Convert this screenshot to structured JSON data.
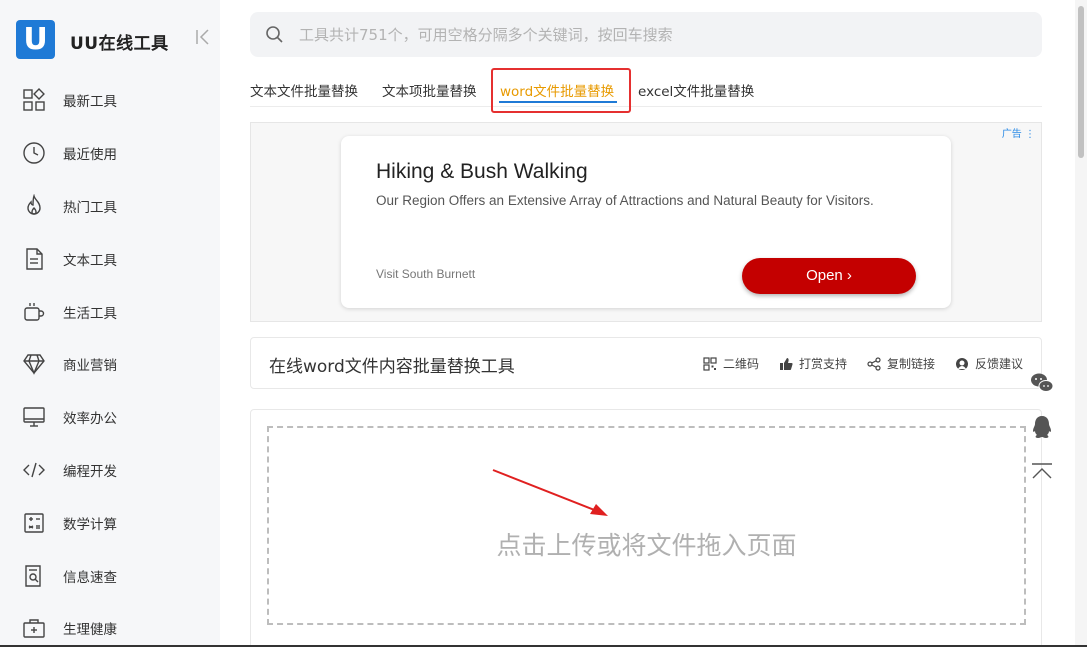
{
  "app": {
    "logo_letter": "U",
    "title": "UU在线工具",
    "collapse_glyph": "<|"
  },
  "sidebar": {
    "items": [
      {
        "label": "最新工具",
        "icon": "grid-icon"
      },
      {
        "label": "最近使用",
        "icon": "clock-icon"
      },
      {
        "label": "热门工具",
        "icon": "flame-icon"
      },
      {
        "label": "文本工具",
        "icon": "document-icon"
      },
      {
        "label": "生活工具",
        "icon": "cup-icon"
      },
      {
        "label": "商业营销",
        "icon": "diamond-icon"
      },
      {
        "label": "效率办公",
        "icon": "monitor-icon"
      },
      {
        "label": "编程开发",
        "icon": "code-icon"
      },
      {
        "label": "数学计算",
        "icon": "calculator-icon"
      },
      {
        "label": "信息速查",
        "icon": "search-doc-icon"
      },
      {
        "label": "生理健康",
        "icon": "medkit-icon"
      }
    ]
  },
  "search": {
    "placeholder": "工具共计751个，可用空格分隔多个关键词，按回车搜索",
    "value": ""
  },
  "tabs": [
    {
      "label": "文本文件批量替换",
      "active": false
    },
    {
      "label": "文本项批量替换",
      "active": false
    },
    {
      "label": "word文件批量替换",
      "active": true
    },
    {
      "label": "excel文件批量替换",
      "active": false
    }
  ],
  "ad": {
    "tag": "广告 ⋮",
    "title": "Hiking & Bush Walking",
    "description": "Our Region Offers an Extensive Array of Attractions and Natural Beauty for Visitors.",
    "source": "Visit South Burnett",
    "button": "Open ›"
  },
  "tool": {
    "title": "在线word文件内容批量替换工具",
    "actions": [
      {
        "label": "二维码",
        "icon": "qrcode-icon"
      },
      {
        "label": "打赏支持",
        "icon": "thumbs-up-icon"
      },
      {
        "label": "复制链接",
        "icon": "share-icon"
      },
      {
        "label": "反馈建议",
        "icon": "feedback-icon"
      }
    ]
  },
  "upload": {
    "text": "点击上传或将文件拖入页面"
  },
  "colors": {
    "brand": "#1f7ad6",
    "active_tab": "#e89a00",
    "highlight_box": "#e53030",
    "ad_button": "#c40000"
  }
}
